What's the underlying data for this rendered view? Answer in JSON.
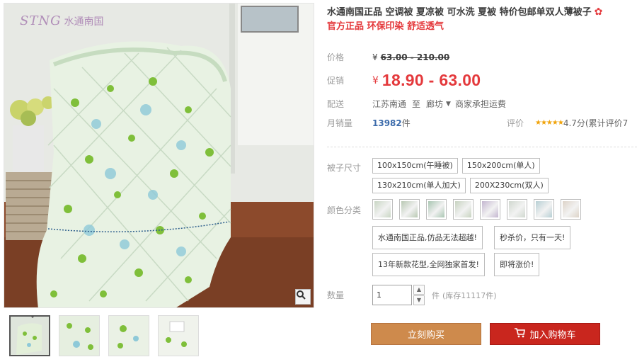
{
  "brand": {
    "logo_en": "STNG",
    "logo_cn": "水通南国"
  },
  "product": {
    "title": "水通南国正品 空调被 夏凉被 可水洗 夏被 特价包邮单双人薄被子",
    "subtitle": "官方正品 环保印染 舒适透气"
  },
  "price": {
    "label": "价格",
    "currency": "¥",
    "original": "63.00 - 210.00"
  },
  "promo_price": {
    "label": "促销",
    "currency": "¥",
    "value": "18.90 - 63.00"
  },
  "shipping": {
    "label": "配送",
    "from": "江苏南通",
    "to_word": "至",
    "to": "廊坊",
    "note": "商家承担运费"
  },
  "sales": {
    "label": "月销量",
    "count": "13982",
    "unit": "件"
  },
  "rating": {
    "label": "评价",
    "stars": "★★★★★",
    "score_text": "4.7分(累计评价7"
  },
  "sizes": {
    "label": "被子尺寸",
    "options": [
      "100x150cm(午睡被)",
      "150x200cm(单人)",
      "130x210cm(单人加大)",
      "200X230cm(双人)"
    ]
  },
  "colors": {
    "label": "颜色分类",
    "swatches": [
      "#c9d6c4",
      "#b9c9b3",
      "#a9c6b2",
      "#c7d3c0",
      "#c4b6d0",
      "#d0d8cf",
      "#b7cfd4",
      "#ddd3c8"
    ]
  },
  "promos": [
    "水通南国正品,仿品无法超越!",
    "秒杀价，只有一天!",
    "13年新款花型,全网独家首发!",
    "即将涨价!"
  ],
  "quantity": {
    "label": "数量",
    "value": "1",
    "unit": "件",
    "stock": "(库存11117件)"
  },
  "buttons": {
    "buy_now": "立刻购买",
    "add_cart": "加入购物车"
  },
  "icons": {
    "zoom": "zoom-icon",
    "cart": "cart-icon",
    "flower": "flower-icon"
  },
  "colors_ui": {
    "accent": "#e4393c",
    "buy": "#ce8a4c",
    "cart": "#c9261e"
  }
}
